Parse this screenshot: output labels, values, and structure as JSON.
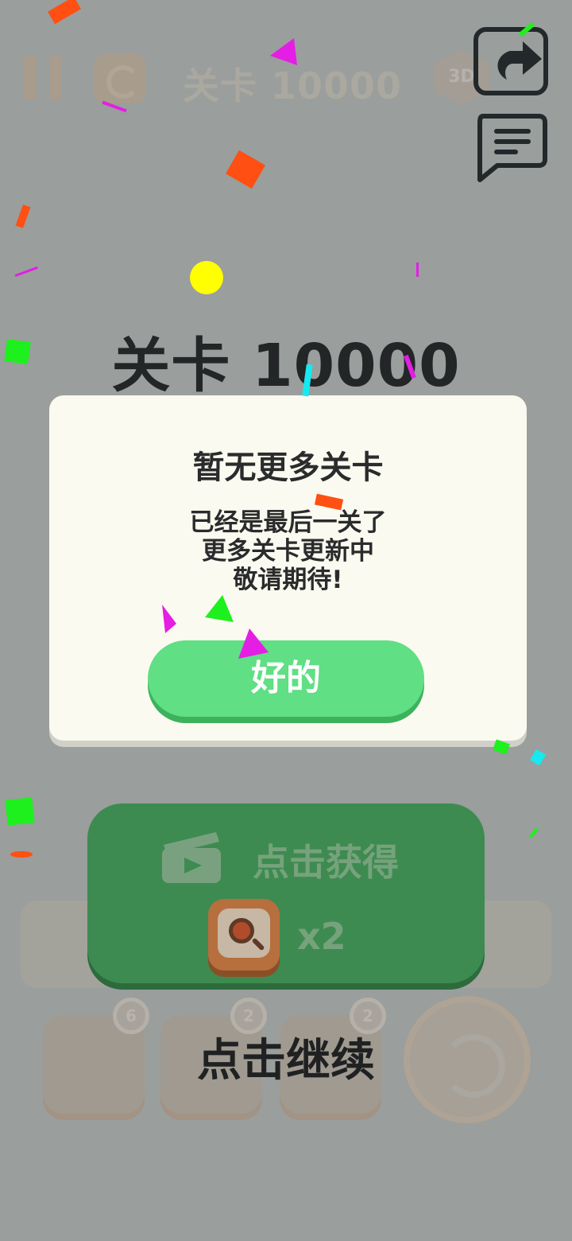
{
  "hud": {
    "level_label": "关卡 10000",
    "badge_3d": "3D"
  },
  "level_title": "关卡 10000",
  "dialog": {
    "title": "暂无更多关卡",
    "lines": [
      "已经是最后一关了",
      "更多关卡更新中",
      "敬请期待!"
    ],
    "ok_label": "好的"
  },
  "reward": {
    "label": "点击获得",
    "multiplier": "x2"
  },
  "background_tools": {
    "badges": [
      "6",
      "2",
      "2"
    ]
  },
  "continue_text": "点击继续",
  "icons": {
    "share": "share-icon",
    "chat": "chat-icon",
    "clapperboard": "clapperboard-icon",
    "magnifier": "magnifier-icon"
  },
  "colors": {
    "background": "#9a9e9d",
    "dialog": "#fbfaf0",
    "ok_button": "#60df84",
    "reward_button": "#3d8b51"
  }
}
